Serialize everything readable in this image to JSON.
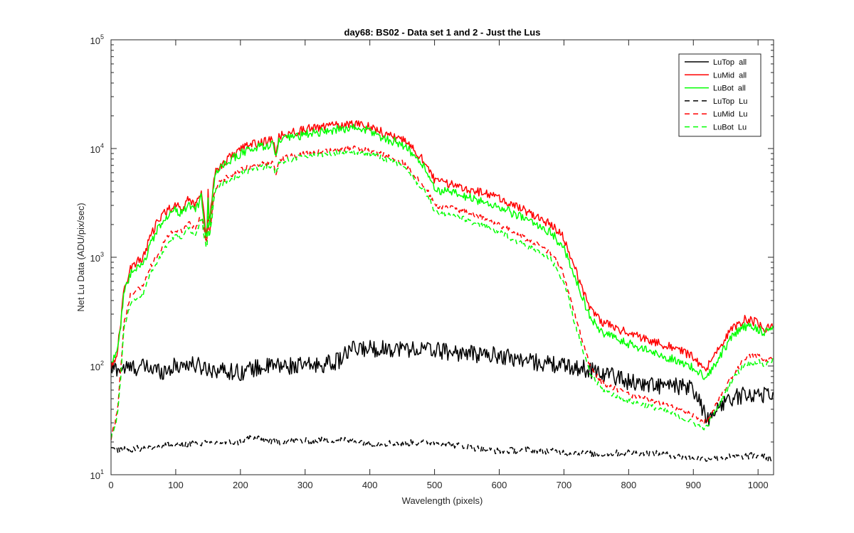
{
  "chart_data": {
    "type": "line",
    "title": "day68: BS02 - Data set 1 and 2 - Just the Lus",
    "xlabel": "Wavelength (pixels)",
    "ylabel": "Net Lu Data (ADU/pix/sec)",
    "xlim": [
      0,
      1024
    ],
    "ylim": [
      10,
      100000
    ],
    "yscale": "log",
    "x_ticks": [
      0,
      100,
      200,
      300,
      400,
      500,
      600,
      700,
      800,
      900,
      1000
    ],
    "y_ticks": [
      {
        "base": "10",
        "exp": "1",
        "value": 10
      },
      {
        "base": "10",
        "exp": "2",
        "value": 100
      },
      {
        "base": "10",
        "exp": "3",
        "value": 1000
      },
      {
        "base": "10",
        "exp": "4",
        "value": 10000
      },
      {
        "base": "10",
        "exp": "5",
        "value": 100000
      }
    ],
    "legend_position": "top-right",
    "series": [
      {
        "name": "LuTop  all",
        "color": "#000000",
        "style": "solid",
        "noise": 0.08,
        "x": [
          0,
          20,
          50,
          80,
          100,
          120,
          150,
          180,
          200,
          220,
          250,
          280,
          300,
          320,
          350,
          370,
          400,
          450,
          500,
          550,
          600,
          650,
          700,
          730,
          750,
          780,
          800,
          850,
          880,
          900,
          915,
          925,
          940,
          960,
          980,
          1000,
          1024
        ],
        "y": [
          95,
          95,
          98,
          90,
          100,
          105,
          95,
          90,
          88,
          95,
          100,
          100,
          100,
          102,
          110,
          140,
          145,
          145,
          140,
          130,
          125,
          110,
          100,
          95,
          90,
          80,
          72,
          65,
          65,
          60,
          40,
          30,
          45,
          50,
          55,
          55,
          55
        ]
      },
      {
        "name": "LuMid  all",
        "color": "#ff0000",
        "style": "solid",
        "noise": 0.04,
        "x": [
          0,
          5,
          10,
          15,
          20,
          30,
          40,
          50,
          60,
          70,
          80,
          90,
          100,
          110,
          120,
          130,
          140,
          148,
          150,
          152,
          160,
          170,
          180,
          200,
          220,
          250,
          255,
          260,
          280,
          300,
          350,
          380,
          400,
          420,
          450,
          470,
          490,
          500,
          520,
          550,
          600,
          650,
          680,
          700,
          720,
          740,
          760,
          800,
          850,
          880,
          900,
          910,
          920,
          940,
          960,
          980,
          1000,
          1010,
          1024
        ],
        "y": [
          100,
          110,
          140,
          250,
          500,
          800,
          900,
          1000,
          1500,
          2000,
          2500,
          2800,
          3000,
          2800,
          3500,
          3000,
          4000,
          1500,
          4000,
          2000,
          6000,
          7000,
          8000,
          10000,
          11000,
          12000,
          9000,
          13000,
          14000,
          15000,
          16500,
          17000,
          16000,
          14000,
          12000,
          9500,
          7000,
          5000,
          4800,
          4300,
          3500,
          2500,
          2000,
          1500,
          700,
          350,
          250,
          200,
          160,
          140,
          120,
          100,
          95,
          150,
          220,
          270,
          250,
          220,
          230
        ]
      },
      {
        "name": "LuBot  all",
        "color": "#00ff00",
        "style": "solid",
        "noise": 0.04,
        "x": [
          0,
          5,
          10,
          15,
          20,
          30,
          40,
          50,
          60,
          70,
          80,
          90,
          100,
          110,
          120,
          130,
          140,
          148,
          150,
          152,
          160,
          170,
          180,
          200,
          220,
          250,
          255,
          260,
          280,
          300,
          350,
          380,
          400,
          420,
          450,
          470,
          490,
          500,
          520,
          550,
          600,
          650,
          680,
          700,
          720,
          740,
          760,
          800,
          850,
          880,
          900,
          910,
          920,
          940,
          960,
          980,
          1000,
          1010,
          1024
        ],
        "y": [
          110,
          120,
          150,
          240,
          450,
          700,
          780,
          850,
          1300,
          1700,
          2200,
          2500,
          2700,
          2500,
          3100,
          2700,
          3600,
          1300,
          3600,
          1800,
          5500,
          6500,
          7500,
          9000,
          10000,
          11000,
          8200,
          12000,
          12500,
          13500,
          15000,
          15500,
          14500,
          12500,
          11000,
          8500,
          6000,
          4200,
          4000,
          3600,
          2900,
          2100,
          1700,
          1200,
          600,
          280,
          200,
          160,
          125,
          110,
          95,
          85,
          80,
          120,
          190,
          230,
          220,
          200,
          240
        ]
      },
      {
        "name": "LuTop  Lu",
        "color": "#000000",
        "style": "dashed",
        "noise": 0.03,
        "x": [
          0,
          50,
          100,
          150,
          200,
          215,
          250,
          300,
          350,
          380,
          400,
          450,
          500,
          550,
          600,
          650,
          700,
          750,
          800,
          850,
          900,
          950,
          1000,
          1024
        ],
        "y": [
          17,
          17.5,
          19,
          19.5,
          20,
          22,
          20,
          20.5,
          21,
          20.5,
          19.5,
          19.5,
          20,
          18,
          16.5,
          17,
          16,
          15.5,
          16,
          15.5,
          14,
          14.5,
          15,
          14
        ]
      },
      {
        "name": "LuMid  Lu",
        "color": "#ff0000",
        "style": "dashed",
        "noise": 0.025,
        "x": [
          0,
          5,
          10,
          15,
          20,
          30,
          40,
          50,
          60,
          70,
          80,
          90,
          100,
          110,
          120,
          130,
          140,
          148,
          150,
          152,
          160,
          170,
          180,
          200,
          220,
          250,
          255,
          260,
          280,
          300,
          350,
          380,
          400,
          420,
          450,
          470,
          490,
          500,
          520,
          550,
          600,
          650,
          680,
          700,
          720,
          740,
          760,
          800,
          850,
          880,
          900,
          910,
          920,
          940,
          960,
          980,
          1000,
          1010,
          1024
        ],
        "y": [
          22,
          28,
          40,
          90,
          250,
          450,
          500,
          550,
          800,
          1000,
          1300,
          1600,
          1800,
          1700,
          2100,
          1800,
          2500,
          1200,
          2500,
          1500,
          4200,
          5000,
          5500,
          6300,
          7000,
          7500,
          6000,
          8000,
          8500,
          9000,
          9800,
          10000,
          9500,
          8800,
          7500,
          5500,
          4000,
          3000,
          2900,
          2600,
          2000,
          1400,
          1100,
          700,
          250,
          100,
          70,
          55,
          45,
          40,
          35,
          32,
          30,
          50,
          80,
          120,
          125,
          110,
          120
        ]
      },
      {
        "name": "LuBot  Lu",
        "color": "#00ff00",
        "style": "dashed",
        "noise": 0.025,
        "x": [
          0,
          5,
          10,
          15,
          20,
          30,
          40,
          50,
          60,
          70,
          80,
          90,
          100,
          110,
          120,
          130,
          140,
          148,
          150,
          152,
          160,
          170,
          180,
          200,
          220,
          250,
          255,
          260,
          280,
          300,
          350,
          380,
          400,
          420,
          450,
          470,
          490,
          500,
          520,
          550,
          600,
          650,
          680,
          700,
          720,
          740,
          760,
          800,
          850,
          880,
          900,
          910,
          920,
          940,
          960,
          980,
          1000,
          1010,
          1024
        ],
        "y": [
          22,
          25,
          35,
          80,
          220,
          380,
          420,
          460,
          680,
          850,
          1100,
          1400,
          1600,
          1500,
          1900,
          1600,
          2300,
          1100,
          2300,
          1400,
          3900,
          4600,
          5000,
          5800,
          6500,
          7000,
          5700,
          7500,
          8000,
          8500,
          9200,
          9300,
          9000,
          8200,
          7000,
          5100,
          3700,
          2600,
          2500,
          2200,
          1700,
          1200,
          950,
          600,
          210,
          85,
          60,
          48,
          40,
          34,
          30,
          28,
          27,
          45,
          75,
          105,
          110,
          100,
          115
        ]
      }
    ]
  }
}
